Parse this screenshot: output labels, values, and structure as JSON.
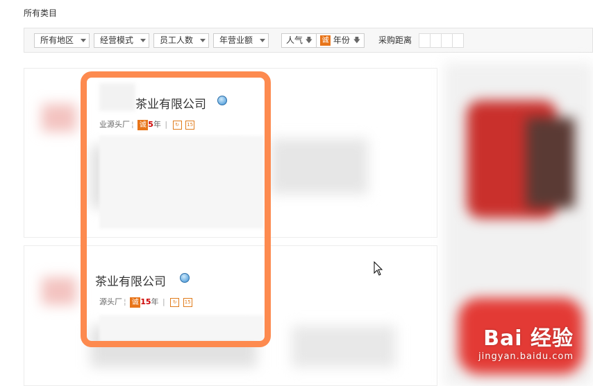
{
  "category_title": "所有类目",
  "filters": {
    "region": "所有地区",
    "business_mode": "经营模式",
    "employees": "员工人数",
    "annual_revenue": "年营业额"
  },
  "sorts": {
    "popularity": "人气",
    "years_badge": "诚",
    "years": "年份"
  },
  "distance_label": "采购距离",
  "listings": [
    {
      "company_name": "茶业有限公司",
      "meta_prefix": "业源头厂",
      "badge": "诚",
      "years_num": "5",
      "years_unit": "年",
      "calendar_num": "15"
    },
    {
      "company_name": "茶业有限公司",
      "meta_prefix": "源头厂",
      "badge": "诚",
      "years_num": "15",
      "years_unit": "年",
      "calendar_num": "15"
    }
  ],
  "watermark": {
    "main": "Bai 经验",
    "sub": "jingyan.baidu.com"
  },
  "colors": {
    "highlight": "#fd8a4f",
    "badge": "#e8751a",
    "years_text": "#cc0000"
  }
}
